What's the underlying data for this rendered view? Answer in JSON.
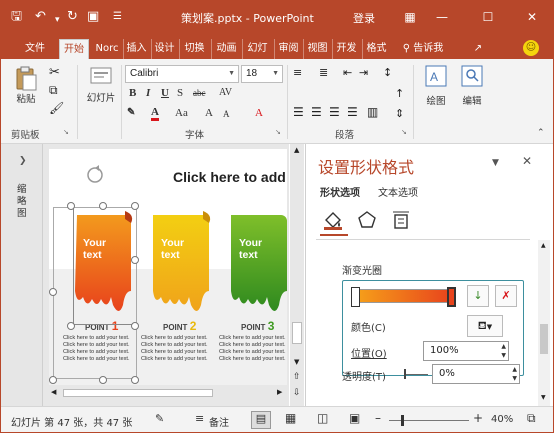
{
  "window": {
    "title": "策划案.pptx - PowerPoint",
    "login": "登录"
  },
  "tabs": [
    "文件",
    "开始",
    "Norc",
    "插入",
    "设计",
    "切换",
    "动画",
    "幻灯片",
    "审阅",
    "视图",
    "开发",
    "格式"
  ],
  "tell_me": "告诉我",
  "ribbon": {
    "paste": "粘贴",
    "slides": "幻灯片",
    "font_name": "Calibri",
    "font_size": "18",
    "drawing": "绘图",
    "editing": "编辑",
    "groups": {
      "clipboard": "剪贴板",
      "font": "字体",
      "paragraph": "段落"
    }
  },
  "left_panel": {
    "label": "缩略图"
  },
  "slide": {
    "title": "Click here to add",
    "cards": [
      {
        "text": "Your text",
        "point": "POINT",
        "num": "1",
        "color": "#e8431c"
      },
      {
        "text": "Your text",
        "point": "POINT",
        "num": "2",
        "color": "#e8b90e"
      },
      {
        "text": "Your text",
        "point": "POINT",
        "num": "3",
        "color": "#3f9a22"
      }
    ],
    "body": "Click here to add your text. Click here to add your text. Click here to add your text. Click here to add your text."
  },
  "pane": {
    "title": "设置形状格式",
    "tab_shape": "形状选项",
    "tab_text": "文本选项",
    "gradient_label": "渐变光圈",
    "color_label": "颜色(C)",
    "position_label": "位置(O)",
    "position_value": "100%",
    "transparency_label": "透明度(T)",
    "transparency_value": "0%",
    "accent": "#b7472a"
  },
  "status": {
    "slide_info": "幻灯片 第 47 张，共 47 张",
    "notes": "备注",
    "zoom": "40%"
  }
}
